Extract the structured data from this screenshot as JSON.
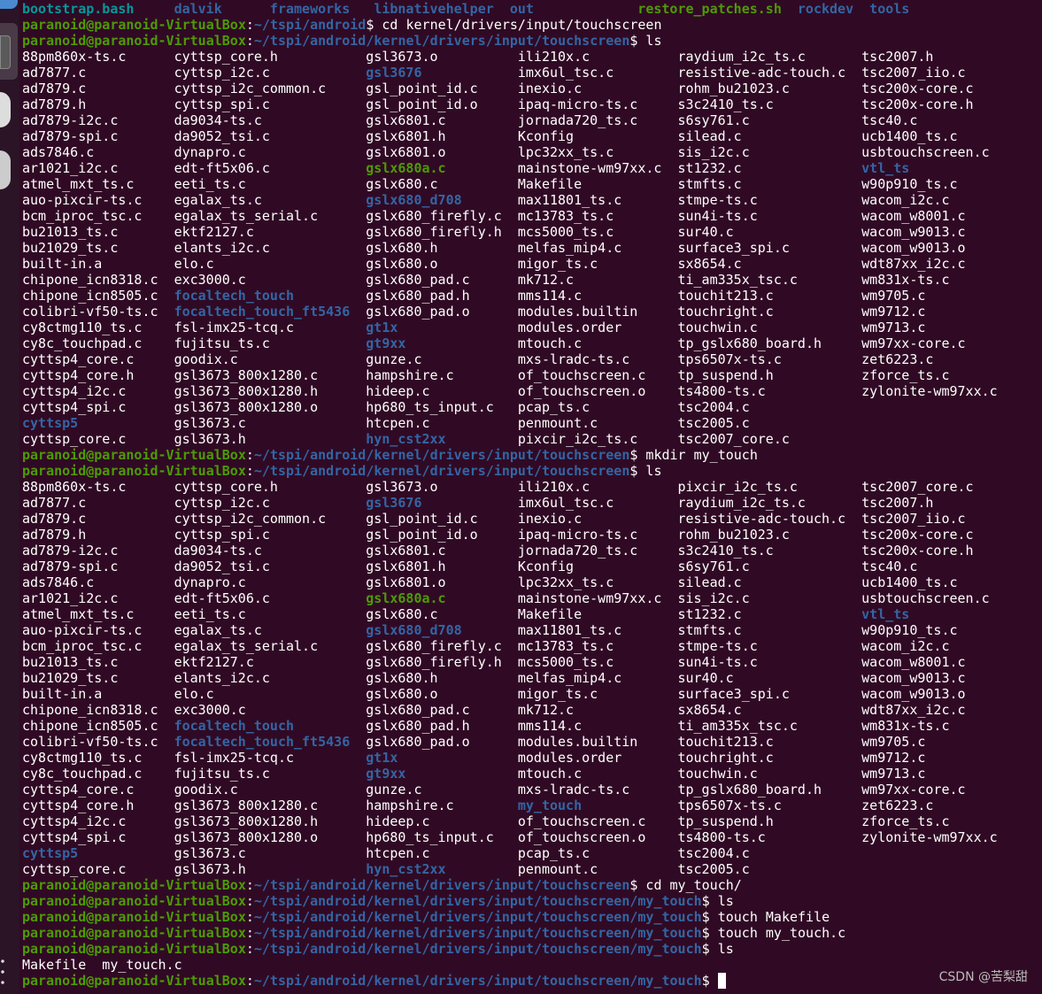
{
  "colors": {
    "background": "#300a24",
    "prompt_user": "#4e9a06",
    "prompt_path": "#3465a4",
    "directory": "#3465a4",
    "executable": "#4e9a06",
    "link": "#06989a",
    "text": "#ffffff"
  },
  "header_line": [
    {
      "name": "bootstrap.bash",
      "kind": "link"
    },
    {
      "name": "dalvik",
      "kind": "dir"
    },
    {
      "name": "frameworks",
      "kind": "dir"
    },
    {
      "name": "libnativehelper",
      "kind": "dir"
    },
    {
      "name": "out",
      "kind": "dir"
    },
    {
      "name": "restore_patches.sh",
      "kind": "exec"
    },
    {
      "name": "rockdev",
      "kind": "dir"
    },
    {
      "name": "tools",
      "kind": "dir"
    }
  ],
  "blocks": [
    {
      "type": "prompt",
      "user": "paranoid@paranoid-VirtualBox",
      "path": "~/tspi/android",
      "command": "cd kernel/drivers/input/touchscreen"
    },
    {
      "type": "prompt",
      "user": "paranoid@paranoid-VirtualBox",
      "path": "~/tspi/android/kernel/drivers/input/touchscreen",
      "command": "ls"
    },
    {
      "type": "ls",
      "directories": [
        "gsl3676",
        "gslx680_d708",
        "focaltech_touch",
        "focaltech_touch_ft5436",
        "gt1x",
        "gt9xx",
        "hyn_cst2xx",
        "cyttsp5",
        "vtl_ts"
      ],
      "executables": [
        "gslx680a.c"
      ],
      "columns": [
        [
          "88pm860x-ts.c",
          "ad7877.c",
          "ad7879.c",
          "ad7879.h",
          "ad7879-i2c.c",
          "ad7879-spi.c",
          "ads7846.c",
          "ar1021_i2c.c",
          "atmel_mxt_ts.c",
          "auo-pixcir-ts.c",
          "bcm_iproc_tsc.c",
          "bu21013_ts.c",
          "bu21029_ts.c",
          "built-in.a",
          "chipone_icn8318.c",
          "chipone_icn8505.c",
          "colibri-vf50-ts.c",
          "cy8ctmg110_ts.c",
          "cy8c_touchpad.c",
          "cyttsp4_core.c",
          "cyttsp4_core.h",
          "cyttsp4_i2c.c",
          "cyttsp4_spi.c",
          "cyttsp5",
          "cyttsp_core.c"
        ],
        [
          "cyttsp_core.h",
          "cyttsp_i2c.c",
          "cyttsp_i2c_common.c",
          "cyttsp_spi.c",
          "da9034-ts.c",
          "da9052_tsi.c",
          "dynapro.c",
          "edt-ft5x06.c",
          "eeti_ts.c",
          "egalax_ts.c",
          "egalax_ts_serial.c",
          "ektf2127.c",
          "elants_i2c.c",
          "elo.c",
          "exc3000.c",
          "focaltech_touch",
          "focaltech_touch_ft5436",
          "fsl-imx25-tcq.c",
          "fujitsu_ts.c",
          "goodix.c",
          "gsl3673_800x1280.c",
          "gsl3673_800x1280.h",
          "gsl3673_800x1280.o",
          "gsl3673.c",
          "gsl3673.h"
        ],
        [
          "gsl3673.o",
          "gsl3676",
          "gsl_point_id.c",
          "gsl_point_id.o",
          "gslx6801.c",
          "gslx6801.h",
          "gslx6801.o",
          "gslx680a.c",
          "gslx680.c",
          "gslx680_d708",
          "gslx680_firefly.c",
          "gslx680_firefly.h",
          "gslx680.h",
          "gslx680.o",
          "gslx680_pad.c",
          "gslx680_pad.h",
          "gslx680_pad.o",
          "gt1x",
          "gt9xx",
          "gunze.c",
          "hampshire.c",
          "hideep.c",
          "hp680_ts_input.c",
          "htcpen.c",
          "hyn_cst2xx"
        ],
        [
          "ili210x.c",
          "imx6ul_tsc.c",
          "inexio.c",
          "ipaq-micro-ts.c",
          "jornada720_ts.c",
          "Kconfig",
          "lpc32xx_ts.c",
          "mainstone-wm97xx.c",
          "Makefile",
          "max11801_ts.c",
          "mc13783_ts.c",
          "mcs5000_ts.c",
          "melfas_mip4.c",
          "migor_ts.c",
          "mk712.c",
          "mms114.c",
          "modules.builtin",
          "modules.order",
          "mtouch.c",
          "mxs-lradc-ts.c",
          "of_touchscreen.c",
          "of_touchscreen.o",
          "pcap_ts.c",
          "penmount.c",
          "pixcir_i2c_ts.c"
        ],
        [
          "raydium_i2c_ts.c",
          "resistive-adc-touch.c",
          "rohm_bu21023.c",
          "s3c2410_ts.c",
          "s6sy761.c",
          "silead.c",
          "sis_i2c.c",
          "st1232.c",
          "stmfts.c",
          "stmpe-ts.c",
          "sun4i-ts.c",
          "sur40.c",
          "surface3_spi.c",
          "sx8654.c",
          "ti_am335x_tsc.c",
          "touchit213.c",
          "touchright.c",
          "touchwin.c",
          "tp_gslx680_board.h",
          "tps6507x-ts.c",
          "tp_suspend.h",
          "ts4800-ts.c",
          "tsc2004.c",
          "tsc2005.c",
          "tsc2007_core.c"
        ],
        [
          "tsc2007.h",
          "tsc2007_iio.c",
          "tsc200x-core.c",
          "tsc200x-core.h",
          "tsc40.c",
          "ucb1400_ts.c",
          "usbtouchscreen.c",
          "vtl_ts",
          "w90p910_ts.c",
          "wacom_i2c.c",
          "wacom_w8001.c",
          "wacom_w9013.c",
          "wacom_w9013.o",
          "wdt87xx_i2c.c",
          "wm831x-ts.c",
          "wm9705.c",
          "wm9712.c",
          "wm9713.c",
          "wm97xx-core.c",
          "zet6223.c",
          "zforce_ts.c",
          "zylonite-wm97xx.c"
        ]
      ]
    },
    {
      "type": "prompt",
      "user": "paranoid@paranoid-VirtualBox",
      "path": "~/tspi/android/kernel/drivers/input/touchscreen",
      "command": "mkdir my_touch"
    },
    {
      "type": "prompt",
      "user": "paranoid@paranoid-VirtualBox",
      "path": "~/tspi/android/kernel/drivers/input/touchscreen",
      "command": "ls"
    },
    {
      "type": "ls",
      "directories": [
        "gsl3676",
        "gslx680_d708",
        "focaltech_touch",
        "focaltech_touch_ft5436",
        "gt1x",
        "gt9xx",
        "hyn_cst2xx",
        "cyttsp5",
        "vtl_ts",
        "my_touch"
      ],
      "executables": [
        "gslx680a.c"
      ],
      "columns": [
        [
          "88pm860x-ts.c",
          "ad7877.c",
          "ad7879.c",
          "ad7879.h",
          "ad7879-i2c.c",
          "ad7879-spi.c",
          "ads7846.c",
          "ar1021_i2c.c",
          "atmel_mxt_ts.c",
          "auo-pixcir-ts.c",
          "bcm_iproc_tsc.c",
          "bu21013_ts.c",
          "bu21029_ts.c",
          "built-in.a",
          "chipone_icn8318.c",
          "chipone_icn8505.c",
          "colibri-vf50-ts.c",
          "cy8ctmg110_ts.c",
          "cy8c_touchpad.c",
          "cyttsp4_core.c",
          "cyttsp4_core.h",
          "cyttsp4_i2c.c",
          "cyttsp4_spi.c",
          "cyttsp5",
          "cyttsp_core.c"
        ],
        [
          "cyttsp_core.h",
          "cyttsp_i2c.c",
          "cyttsp_i2c_common.c",
          "cyttsp_spi.c",
          "da9034-ts.c",
          "da9052_tsi.c",
          "dynapro.c",
          "edt-ft5x06.c",
          "eeti_ts.c",
          "egalax_ts.c",
          "egalax_ts_serial.c",
          "ektf2127.c",
          "elants_i2c.c",
          "elo.c",
          "exc3000.c",
          "focaltech_touch",
          "focaltech_touch_ft5436",
          "fsl-imx25-tcq.c",
          "fujitsu_ts.c",
          "goodix.c",
          "gsl3673_800x1280.c",
          "gsl3673_800x1280.h",
          "gsl3673_800x1280.o",
          "gsl3673.c",
          "gsl3673.h"
        ],
        [
          "gsl3673.o",
          "gsl3676",
          "gsl_point_id.c",
          "gsl_point_id.o",
          "gslx6801.c",
          "gslx6801.h",
          "gslx6801.o",
          "gslx680a.c",
          "gslx680.c",
          "gslx680_d708",
          "gslx680_firefly.c",
          "gslx680_firefly.h",
          "gslx680.h",
          "gslx680.o",
          "gslx680_pad.c",
          "gslx680_pad.h",
          "gslx680_pad.o",
          "gt1x",
          "gt9xx",
          "gunze.c",
          "hampshire.c",
          "hideep.c",
          "hp680_ts_input.c",
          "htcpen.c",
          "hyn_cst2xx"
        ],
        [
          "ili210x.c",
          "imx6ul_tsc.c",
          "inexio.c",
          "ipaq-micro-ts.c",
          "jornada720_ts.c",
          "Kconfig",
          "lpc32xx_ts.c",
          "mainstone-wm97xx.c",
          "Makefile",
          "max11801_ts.c",
          "mc13783_ts.c",
          "mcs5000_ts.c",
          "melfas_mip4.c",
          "migor_ts.c",
          "mk712.c",
          "mms114.c",
          "modules.builtin",
          "modules.order",
          "mtouch.c",
          "mxs-lradc-ts.c",
          "my_touch",
          "of_touchscreen.c",
          "of_touchscreen.o",
          "pcap_ts.c",
          "penmount.c"
        ],
        [
          "pixcir_i2c_ts.c",
          "raydium_i2c_ts.c",
          "resistive-adc-touch.c",
          "rohm_bu21023.c",
          "s3c2410_ts.c",
          "s6sy761.c",
          "silead.c",
          "sis_i2c.c",
          "st1232.c",
          "stmfts.c",
          "stmpe-ts.c",
          "sun4i-ts.c",
          "sur40.c",
          "surface3_spi.c",
          "sx8654.c",
          "ti_am335x_tsc.c",
          "touchit213.c",
          "touchright.c",
          "touchwin.c",
          "tp_gslx680_board.h",
          "tps6507x-ts.c",
          "tp_suspend.h",
          "ts4800-ts.c",
          "tsc2004.c",
          "tsc2005.c"
        ],
        [
          "tsc2007_core.c",
          "tsc2007.h",
          "tsc2007_iio.c",
          "tsc200x-core.c",
          "tsc200x-core.h",
          "tsc40.c",
          "ucb1400_ts.c",
          "usbtouchscreen.c",
          "vtl_ts",
          "w90p910_ts.c",
          "wacom_i2c.c",
          "wacom_w8001.c",
          "wacom_w9013.c",
          "wacom_w9013.o",
          "wdt87xx_i2c.c",
          "wm831x-ts.c",
          "wm9705.c",
          "wm9712.c",
          "wm9713.c",
          "wm97xx-core.c",
          "zet6223.c",
          "zforce_ts.c",
          "zylonite-wm97xx.c"
        ]
      ]
    },
    {
      "type": "prompt",
      "user": "paranoid@paranoid-VirtualBox",
      "path": "~/tspi/android/kernel/drivers/input/touchscreen",
      "command": "cd my_touch/"
    },
    {
      "type": "prompt",
      "user": "paranoid@paranoid-VirtualBox",
      "path": "~/tspi/android/kernel/drivers/input/touchscreen/my_touch",
      "command": "ls"
    },
    {
      "type": "prompt",
      "user": "paranoid@paranoid-VirtualBox",
      "path": "~/tspi/android/kernel/drivers/input/touchscreen/my_touch",
      "command": "touch Makefile"
    },
    {
      "type": "prompt",
      "user": "paranoid@paranoid-VirtualBox",
      "path": "~/tspi/android/kernel/drivers/input/touchscreen/my_touch",
      "command": "touch my_touch.c"
    },
    {
      "type": "prompt",
      "user": "paranoid@paranoid-VirtualBox",
      "path": "~/tspi/android/kernel/drivers/input/touchscreen/my_touch",
      "command": "ls"
    },
    {
      "type": "output",
      "text": "Makefile  my_touch.c"
    },
    {
      "type": "prompt",
      "user": "paranoid@paranoid-VirtualBox",
      "path": "~/tspi/android/kernel/drivers/input/touchscreen/my_touch",
      "command": "",
      "cursor": true
    }
  ],
  "watermark": "CSDN @苦梨甜"
}
